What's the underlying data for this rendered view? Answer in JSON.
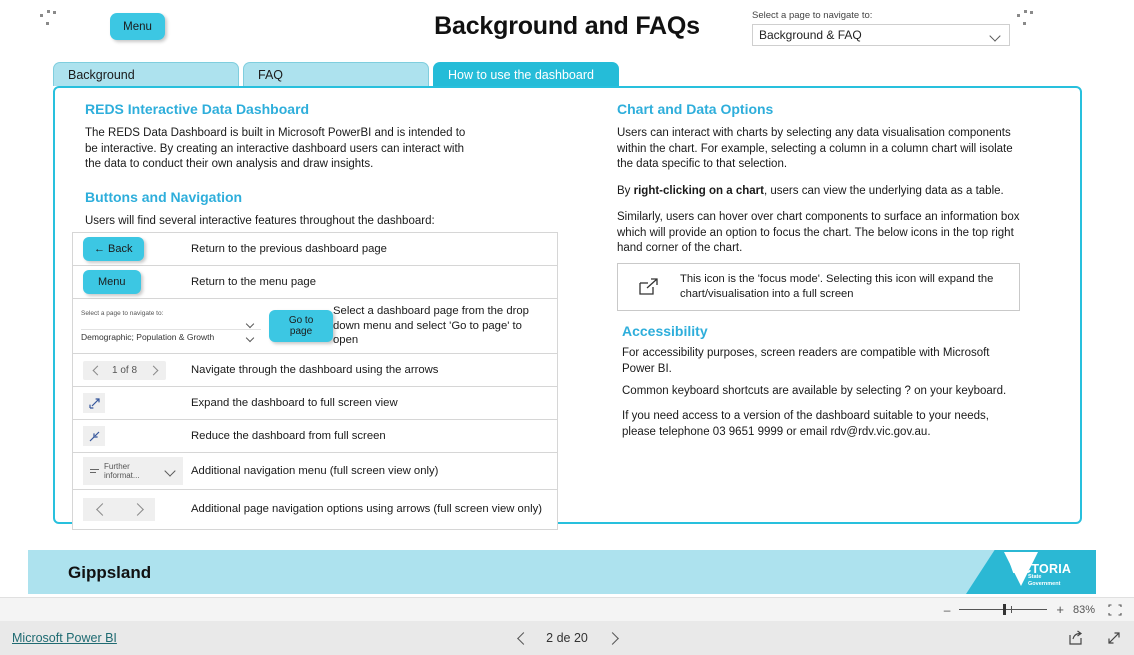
{
  "header": {
    "menu_button": "Menu",
    "title": "Background and FAQs",
    "nav_select_label": "Select a page to navigate to:",
    "nav_select_value": "Background & FAQ"
  },
  "tabs": [
    {
      "label": "Background",
      "active": false
    },
    {
      "label": "FAQ",
      "active": false
    },
    {
      "label": "How to use the dashboard",
      "active": true
    }
  ],
  "left_column": {
    "heading_1": "REDS Interactive Data Dashboard",
    "paragraph_1": "The REDS Data Dashboard is built in Microsoft PowerBI and is intended to be interactive. By creating an interactive dashboard users can interact with the data to conduct their own analysis and draw insights.",
    "heading_2": "Buttons and Navigation",
    "paragraph_2": "Users will find several interactive features throughout the dashboard:"
  },
  "feature_table": {
    "rows": [
      {
        "icon_kind": "back-button",
        "icon_label": "← Back",
        "description": "Return to the previous dashboard page"
      },
      {
        "icon_kind": "menu-button",
        "icon_label": "Menu",
        "description": "Return to the menu page"
      },
      {
        "icon_kind": "page-dropdown",
        "dropdown_label": "Select a page to navigate to:",
        "dropdown_value": "Demographic; Population & Growth",
        "go_button": "Go to page",
        "description": "Select a dashboard page from the drop down menu and select 'Go to page' to open"
      },
      {
        "icon_kind": "pager",
        "pager_text": "1 of 8",
        "description": "Navigate through the dashboard using the arrows"
      },
      {
        "icon_kind": "expand-icon",
        "description": "Expand the dashboard to full screen view"
      },
      {
        "icon_kind": "collapse-icon",
        "description": "Reduce the dashboard from full screen"
      },
      {
        "icon_kind": "further-information-dropdown",
        "dropdown_value": "Further informat...",
        "description": "Additional navigation menu (full screen view only)"
      },
      {
        "icon_kind": "arrow-pager",
        "description": "Additional page navigation options using arrows (full screen view only)"
      }
    ]
  },
  "right_column": {
    "heading_1": "Chart and Data Options",
    "paragraph_1": "Users can interact with charts by selecting any data visualisation components within the chart. For example, selecting a column in a column chart will isolate the data specific to that selection.",
    "paragraph_2_prefix": "By ",
    "paragraph_2_bold": "right-clicking on a chart",
    "paragraph_2_suffix": ", users can view the underlying data as a table.",
    "paragraph_3": "Similarly, users can hover over chart components to surface an information box which will provide an option to focus the chart. The below icons in the top right hand corner of the chart.",
    "focus_note": "This icon is the 'focus mode'. Selecting this icon will expand the chart/visualisation into a full screen",
    "heading_2": "Accessibility",
    "accessibility_1": "For accessibility purposes, screen readers are compatible with Microsoft Power BI.",
    "accessibility_2": "Common keyboard shortcuts are available by selecting ? on your keyboard.",
    "accessibility_3": "If you need access to a version of the dashboard suitable to your needs, please telephone 03 9651 9999 or email  rdv@rdv.vic.gov.au."
  },
  "banner": {
    "region": "Gippsland",
    "logo_word": "VICTORIA",
    "logo_sub_line1": "State",
    "logo_sub_line2": "Government"
  },
  "zoom_bar": {
    "minus": "–",
    "plus": "+",
    "percent": "83%"
  },
  "status_bar": {
    "powerbi_link": "Microsoft Power BI",
    "page_indicator": "2 de 20"
  },
  "colors": {
    "accent_cyan": "#3cc7e3",
    "tab_active": "#25bcd8",
    "tab_inactive": "#ade2ee",
    "heading_blue": "#2eaedb",
    "banner_bg": "#ade2ee",
    "logo_bg": "#2bb8d4",
    "link_teal": "#1f6b72"
  }
}
